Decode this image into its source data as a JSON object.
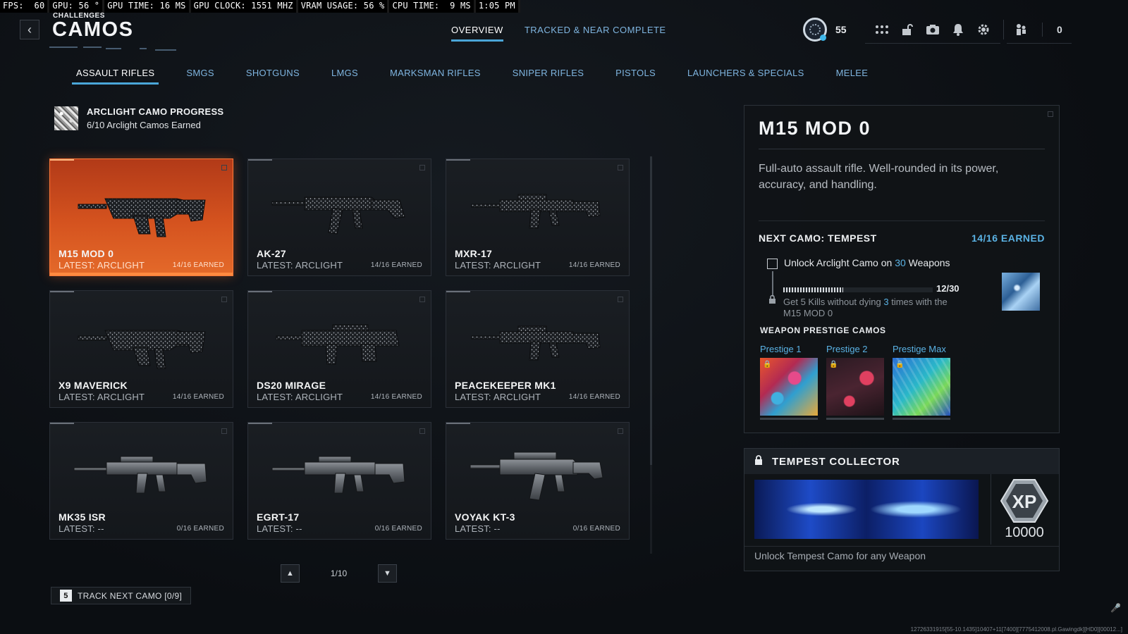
{
  "perf": {
    "fps": "FPS:  60",
    "gpu": "GPU: 56 °",
    "gpu_time": "GPU TIME: 16 MS",
    "gpu_clock": "GPU CLOCK: 1551 MHZ",
    "vram": "VRAM USAGE: 56 %",
    "cpu_time": "CPU TIME:  9 MS",
    "clock": "1:05 PM"
  },
  "header": {
    "breadcrumb": "CHALLENGES",
    "title": "CAMOS",
    "tabs": [
      {
        "label": "OVERVIEW",
        "active": true
      },
      {
        "label": "TRACKED & NEAR COMPLETE",
        "active": false
      }
    ],
    "level": "55",
    "bundle_count": "0"
  },
  "categories": [
    {
      "label": "ASSAULT RIFLES",
      "active": true
    },
    {
      "label": "SMGS"
    },
    {
      "label": "SHOTGUNS"
    },
    {
      "label": "LMGS"
    },
    {
      "label": "MARKSMAN RIFLES"
    },
    {
      "label": "SNIPER RIFLES"
    },
    {
      "label": "PISTOLS"
    },
    {
      "label": "LAUNCHERS & SPECIALS"
    },
    {
      "label": "MELEE"
    }
  ],
  "arclight": {
    "title": "ARCLIGHT CAMO PROGRESS",
    "subtitle": "6/10 Arclight Camos Earned"
  },
  "weapons": [
    {
      "name": "M15 MOD 0",
      "latest": "LATEST: ARCLIGHT",
      "earned": "14/16 EARNED",
      "selected": true,
      "camo": "arclight"
    },
    {
      "name": "AK-27",
      "latest": "LATEST: ARCLIGHT",
      "earned": "14/16 EARNED",
      "camo": "arclight"
    },
    {
      "name": "MXR-17",
      "latest": "LATEST: ARCLIGHT",
      "earned": "14/16 EARNED",
      "camo": "arclight"
    },
    {
      "name": "X9 MAVERICK",
      "latest": "LATEST: ARCLIGHT",
      "earned": "14/16 EARNED",
      "camo": "arclight"
    },
    {
      "name": "DS20 MIRAGE",
      "latest": "LATEST: ARCLIGHT",
      "earned": "14/16 EARNED",
      "camo": "arclight"
    },
    {
      "name": "PEACEKEEPER MK1",
      "latest": "LATEST: ARCLIGHT",
      "earned": "14/16 EARNED",
      "camo": "arclight"
    },
    {
      "name": "MK35 ISR",
      "latest": "LATEST: --",
      "earned": "0/16 EARNED",
      "camo": "none"
    },
    {
      "name": "EGRT-17",
      "latest": "LATEST: --",
      "earned": "0/16 EARNED",
      "camo": "none"
    },
    {
      "name": "VOYAK KT-3",
      "latest": "LATEST: --",
      "earned": "0/16 EARNED",
      "camo": "none"
    }
  ],
  "pager": {
    "label": "1/10"
  },
  "track_next": {
    "key": "5",
    "label": "TRACK NEXT CAMO [0/9]"
  },
  "detail": {
    "title": "M15 MOD 0",
    "description": "Full-auto assault rifle. Well-rounded in its power, accuracy, and handling.",
    "next_camo": "NEXT CAMO: TEMPEST",
    "earned": "14/16 EARNED",
    "challenge_pre": "Unlock Arclight Camo on ",
    "challenge_num": "30",
    "challenge_post": " Weapons",
    "progress_label": "12/30",
    "progress_fraction": 0.4,
    "sub_pre": "Get 5 Kills without dying ",
    "sub_num": "3",
    "sub_post": " times with the M15 MOD 0",
    "prestige_title": "WEAPON PRESTIGE CAMOS",
    "prestige": [
      {
        "label": "Prestige 1"
      },
      {
        "label": "Prestige 2"
      },
      {
        "label": "Prestige Max"
      }
    ]
  },
  "collector": {
    "title": "TEMPEST COLLECTOR",
    "xp": "10000",
    "description": "Unlock Tempest Camo for any Weapon"
  },
  "footer": {
    "build": "12726331915[55-10.1435]10407+11[7400][7775412008.pl.Gawingdk][HD0][00012...]"
  }
}
